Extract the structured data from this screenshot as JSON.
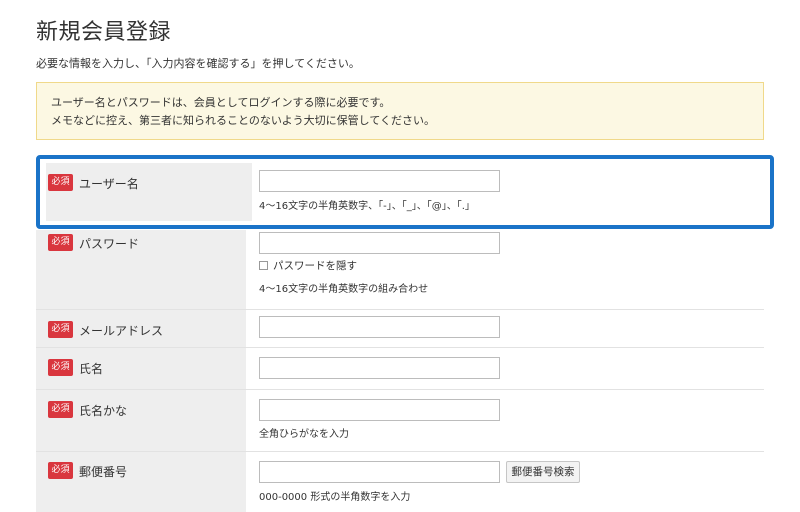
{
  "page": {
    "title": "新規会員登録",
    "intro": "必要な情報を入力し、「入力内容を確認する」を押してください。"
  },
  "notice": {
    "line1": "ユーザー名とパスワードは、会員としてログインする際に必要です。",
    "line2": "メモなどに控え、第三者に知られることのないよう大切に保管してください。"
  },
  "form": {
    "required_badge": "必須",
    "username": {
      "label": "ユーザー名",
      "value": "",
      "help": "4〜16文字の半角英数字、「-」、「_」、「@」、「.」"
    },
    "password": {
      "label": "パスワード",
      "value": "",
      "hide_checkbox_label": "パスワードを隠す",
      "hide_checked": false,
      "help": "4〜16文字の半角英数字の組み合わせ"
    },
    "email": {
      "label": "メールアドレス",
      "value": ""
    },
    "name": {
      "label": "氏名",
      "value": ""
    },
    "name_kana": {
      "label": "氏名かな",
      "value": "",
      "help": "全角ひらがなを入力"
    },
    "postal_code": {
      "label": "郵便番号",
      "value": "",
      "search_button": "郵便番号検索",
      "help": "000-0000 形式の半角数字を入力"
    }
  },
  "colors": {
    "required_badge": "#d9363e",
    "highlight_border": "#1a73c8",
    "notice_bg": "#fcf8e3",
    "label_bg": "#eeeeee"
  }
}
